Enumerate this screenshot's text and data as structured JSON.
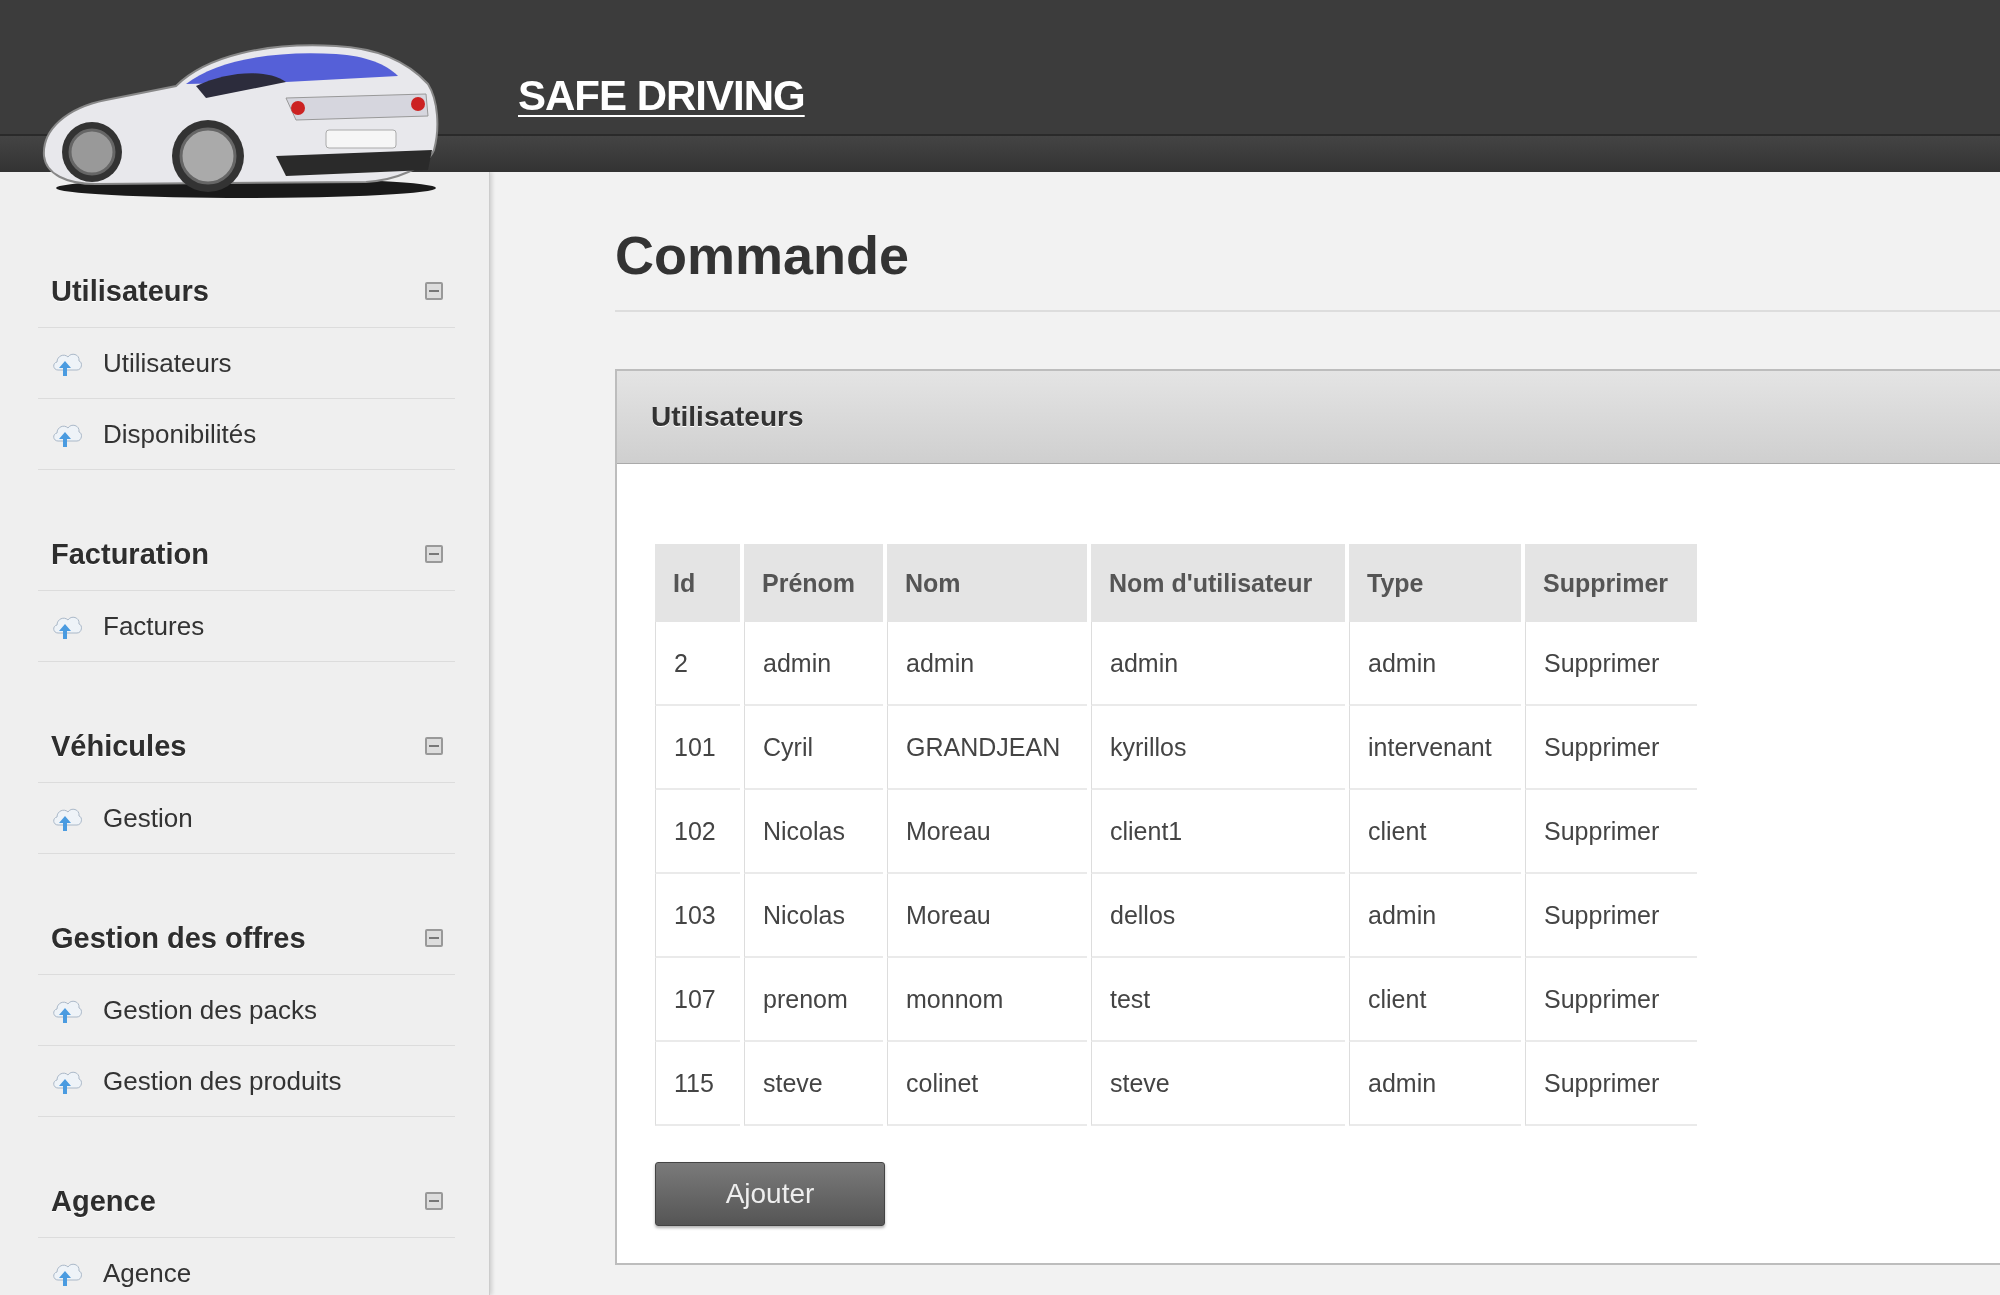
{
  "header": {
    "title": "SAFE DRIVING"
  },
  "sidebar": {
    "sections": [
      {
        "title": "Utilisateurs",
        "expanded": true,
        "items": [
          "Utilisateurs",
          "Disponibilités"
        ]
      },
      {
        "title": "Facturation",
        "expanded": true,
        "items": [
          "Factures"
        ]
      },
      {
        "title": "Véhicules",
        "expanded": true,
        "items": [
          "Gestion"
        ]
      },
      {
        "title": "Gestion des offres",
        "expanded": true,
        "items": [
          "Gestion des packs",
          "Gestion des produits"
        ]
      },
      {
        "title": "Agence",
        "expanded": true,
        "items": [
          "Agence"
        ]
      }
    ]
  },
  "page": {
    "title": "Commande"
  },
  "panel": {
    "title": "Utilisateurs",
    "table": {
      "columns": [
        "Id",
        "Prénom",
        "Nom",
        "Nom d'utilisateur",
        "Type",
        "Supprimer"
      ],
      "rows": [
        [
          "2",
          "admin",
          "admin",
          "admin",
          "admin",
          "Supprimer"
        ],
        [
          "101",
          "Cyril",
          "GRANDJEAN",
          "kyrillos",
          "intervenant",
          "Supprimer"
        ],
        [
          "102",
          "Nicolas",
          "Moreau",
          "client1",
          "client",
          "Supprimer"
        ],
        [
          "103",
          "Nicolas",
          "Moreau",
          "dellos",
          "admin",
          "Supprimer"
        ],
        [
          "107",
          "prenom",
          "monnom",
          "test",
          "client",
          "Supprimer"
        ],
        [
          "115",
          "steve",
          "colinet",
          "steve",
          "admin",
          "Supprimer"
        ]
      ]
    },
    "add_button": "Ajouter"
  }
}
